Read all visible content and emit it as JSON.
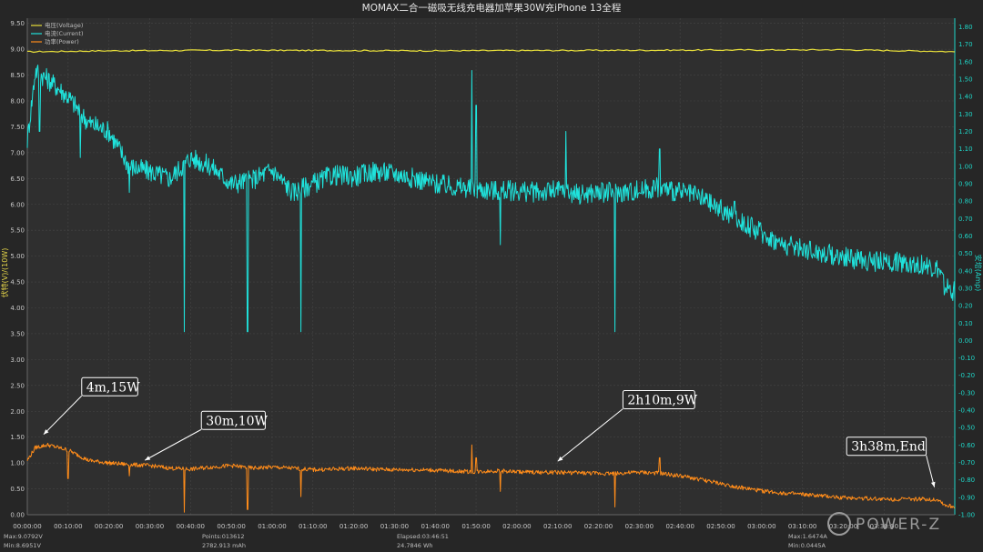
{
  "chart_data": {
    "type": "line",
    "title": "MOMAX二合一磁吸无线充电器加苹果30W充iPhone 13全程",
    "ylabel_left": "伏特(V)/(10W)",
    "ylabel_right": "安培(Amp)",
    "ylim_left": [
      0,
      9.6
    ],
    "ylim_right": [
      -1.0,
      1.85
    ],
    "xlim_seconds": [
      0,
      13640
    ],
    "x_ticks": [
      "00:00:00",
      "00:10:00",
      "00:20:00",
      "00:30:00",
      "00:40:00",
      "00:50:00",
      "01:00:00",
      "01:10:00",
      "01:20:00",
      "01:30:00",
      "01:40:00",
      "01:50:00",
      "02:00:00",
      "02:10:00",
      "02:20:00",
      "02:30:00",
      "02:40:00",
      "02:50:00",
      "03:00:00",
      "03:10:00",
      "03:20:00",
      "03:30:00"
    ],
    "y_ticks_left": [
      "0.00",
      "0.50",
      "1.00",
      "1.50",
      "2.00",
      "2.50",
      "3.00",
      "3.50",
      "4.00",
      "4.50",
      "5.00",
      "5.50",
      "6.00",
      "6.50",
      "7.00",
      "7.50",
      "8.00",
      "8.50",
      "9.00",
      "9.50"
    ],
    "y_ticks_right": [
      "1.80",
      "1.70",
      "1.60",
      "1.50",
      "1.40",
      "1.30",
      "1.20",
      "1.10",
      "1.00",
      "0.90",
      "0.80",
      "0.70",
      "0.60",
      "0.50",
      "0.40",
      "0.30",
      "0.20",
      "0.10",
      "0.00",
      "-0.10",
      "-0.20",
      "-0.30",
      "-0.40",
      "-0.50",
      "-0.60",
      "-0.70",
      "-0.80",
      "-0.90",
      "-1.00"
    ],
    "grid": true,
    "legend": "top-left",
    "series": [
      {
        "name": "电压(Voltage)",
        "axis": "left",
        "color": "#e8df3a",
        "points": [
          [
            0,
            8.95
          ],
          [
            1200,
            8.97
          ],
          [
            3000,
            8.98
          ],
          [
            6000,
            8.97
          ],
          [
            9000,
            8.98
          ],
          [
            12000,
            8.99
          ],
          [
            13400,
            8.96
          ],
          [
            13640,
            8.95
          ]
        ]
      },
      {
        "name": "电流(Current)",
        "axis": "right",
        "color": "#1fe3dc",
        "points": [
          [
            0,
            1.15
          ],
          [
            120,
            1.55
          ],
          [
            300,
            1.5
          ],
          [
            600,
            1.4
          ],
          [
            900,
            1.25
          ],
          [
            1200,
            1.2
          ],
          [
            1500,
            1.0
          ],
          [
            1800,
            0.97
          ],
          [
            2100,
            0.93
          ],
          [
            2400,
            1.05
          ],
          [
            2700,
            1.0
          ],
          [
            3000,
            0.9
          ],
          [
            3300,
            0.92
          ],
          [
            3600,
            0.98
          ],
          [
            3900,
            0.85
          ],
          [
            4200,
            0.9
          ],
          [
            4500,
            0.95
          ],
          [
            4800,
            0.94
          ],
          [
            5100,
            0.97
          ],
          [
            5400,
            0.96
          ],
          [
            5700,
            0.93
          ],
          [
            6000,
            0.9
          ],
          [
            6300,
            0.88
          ],
          [
            6600,
            0.87
          ],
          [
            6900,
            0.86
          ],
          [
            7200,
            0.86
          ],
          [
            7500,
            0.85
          ],
          [
            7800,
            0.86
          ],
          [
            8100,
            0.84
          ],
          [
            8400,
            0.85
          ],
          [
            8700,
            0.85
          ],
          [
            9000,
            0.86
          ],
          [
            9300,
            0.88
          ],
          [
            9600,
            0.85
          ],
          [
            9900,
            0.82
          ],
          [
            10200,
            0.75
          ],
          [
            10500,
            0.68
          ],
          [
            10800,
            0.62
          ],
          [
            11100,
            0.55
          ],
          [
            11400,
            0.53
          ],
          [
            11700,
            0.5
          ],
          [
            12000,
            0.48
          ],
          [
            12300,
            0.46
          ],
          [
            12600,
            0.45
          ],
          [
            12900,
            0.45
          ],
          [
            13200,
            0.43
          ],
          [
            13400,
            0.4
          ],
          [
            13500,
            0.3
          ],
          [
            13640,
            0.28
          ]
        ],
        "dips": [
          [
            180,
            1.2
          ],
          [
            780,
            1.05
          ],
          [
            1500,
            0.85
          ],
          [
            2310,
            0.05
          ],
          [
            3240,
            0.05
          ],
          [
            4020,
            0.05
          ],
          [
            6960,
            0.55
          ],
          [
            8640,
            0.05
          ]
        ],
        "spikes": [
          [
            6540,
            1.55
          ],
          [
            6600,
            1.35
          ],
          [
            7920,
            1.2
          ],
          [
            9300,
            1.1
          ],
          [
            10400,
            0.8
          ]
        ]
      },
      {
        "name": "功率(Power)",
        "axis": "left",
        "color": "#ff8c1a",
        "points": [
          [
            0,
            1.05
          ],
          [
            120,
            1.3
          ],
          [
            300,
            1.35
          ],
          [
            600,
            1.25
          ],
          [
            900,
            1.05
          ],
          [
            1200,
            1.0
          ],
          [
            1500,
            0.97
          ],
          [
            1800,
            0.95
          ],
          [
            2100,
            0.9
          ],
          [
            2400,
            0.88
          ],
          [
            2700,
            0.92
          ],
          [
            3000,
            0.95
          ],
          [
            3300,
            0.9
          ],
          [
            3600,
            0.92
          ],
          [
            3900,
            0.9
          ],
          [
            4200,
            0.87
          ],
          [
            4500,
            0.88
          ],
          [
            4800,
            0.9
          ],
          [
            5100,
            0.88
          ],
          [
            5400,
            0.87
          ],
          [
            5700,
            0.87
          ],
          [
            6000,
            0.86
          ],
          [
            6300,
            0.84
          ],
          [
            6600,
            0.83
          ],
          [
            6900,
            0.85
          ],
          [
            7200,
            0.83
          ],
          [
            7500,
            0.82
          ],
          [
            7800,
            0.82
          ],
          [
            8100,
            0.81
          ],
          [
            8400,
            0.8
          ],
          [
            8700,
            0.8
          ],
          [
            9000,
            0.82
          ],
          [
            9300,
            0.8
          ],
          [
            9600,
            0.75
          ],
          [
            9900,
            0.68
          ],
          [
            10200,
            0.6
          ],
          [
            10500,
            0.52
          ],
          [
            10800,
            0.46
          ],
          [
            11100,
            0.42
          ],
          [
            11400,
            0.39
          ],
          [
            11700,
            0.36
          ],
          [
            12000,
            0.33
          ],
          [
            12300,
            0.32
          ],
          [
            12600,
            0.3
          ],
          [
            12900,
            0.3
          ],
          [
            13200,
            0.3
          ],
          [
            13400,
            0.29
          ],
          [
            13500,
            0.18
          ],
          [
            13640,
            0.15
          ]
        ],
        "dips": [
          [
            600,
            0.7
          ],
          [
            1500,
            0.75
          ],
          [
            2310,
            0.05
          ],
          [
            3240,
            0.1
          ],
          [
            4020,
            0.35
          ],
          [
            6960,
            0.45
          ],
          [
            8640,
            0.15
          ]
        ],
        "spikes": [
          [
            6540,
            1.35
          ],
          [
            6600,
            1.1
          ],
          [
            9300,
            1.1
          ]
        ]
      }
    ],
    "annotations": [
      {
        "text": "4m,15W",
        "point_x": 240,
        "point_y": 1.5,
        "box_x": 800,
        "box_y": 2.65
      },
      {
        "text": "30m,10W",
        "point_x": 1730,
        "point_y": 1.0,
        "box_x": 2560,
        "box_y": 2.0
      },
      {
        "text": "2h10m,9W",
        "point_x": 7800,
        "point_y": 0.98,
        "box_x": 8760,
        "box_y": 2.4
      },
      {
        "text": "3h38m,End",
        "point_x": 13340,
        "point_y": 0.48,
        "box_x": 12050,
        "box_y": 1.5
      }
    ]
  },
  "stats": {
    "max_v": "Max:9.0792V",
    "min_v": "Min:8.6951V",
    "points": "Points:013612",
    "mah": "2782.913 mAh",
    "elapsed": "Elapsed:03:46:51",
    "wh": "24.7846 Wh",
    "max_a": "Max:1.6474A",
    "min_a": "Min:0.0445A"
  },
  "watermark": "POWER-Z"
}
